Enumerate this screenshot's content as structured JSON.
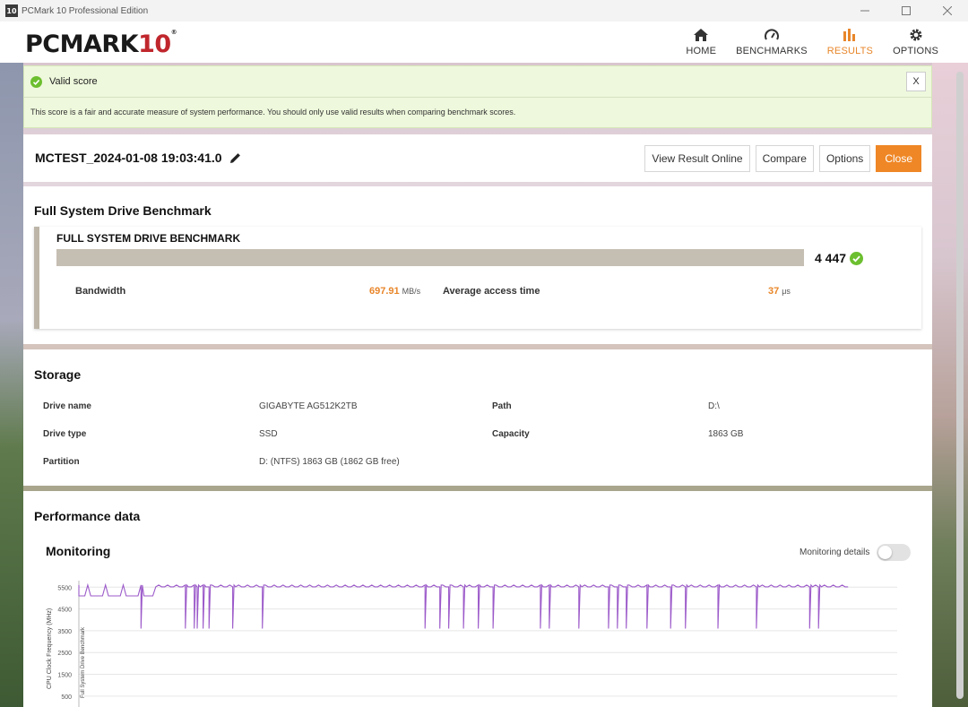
{
  "window": {
    "app_icon": "10",
    "title": "PCMark 10 Professional Edition"
  },
  "brand": {
    "main": "PCMARK",
    "num": "10",
    "reg": "®",
    "accent_color": "#c0272d"
  },
  "nav": [
    {
      "label": "HOME",
      "icon": "home-icon",
      "active": false
    },
    {
      "label": "BENCHMARKS",
      "icon": "speedometer-icon",
      "active": false
    },
    {
      "label": "RESULTS",
      "icon": "bar-chart-icon",
      "active": true
    },
    {
      "label": "OPTIONS",
      "icon": "gear-icon",
      "active": false
    }
  ],
  "valid": {
    "title": "Valid score",
    "close_label": "X",
    "description": "This score is a fair and accurate measure of system performance. You should only use valid results when comparing benchmark scores."
  },
  "result": {
    "name": "MCTEST_2024-01-08 19:03:41.0",
    "buttons": {
      "view_online": "View Result Online",
      "compare": "Compare",
      "options": "Options",
      "close": "Close"
    }
  },
  "benchmark": {
    "section_title": "Full System Drive Benchmark",
    "card_title": "FULL SYSTEM DRIVE BENCHMARK",
    "score": "4 447",
    "bandwidth_label": "Bandwidth",
    "bandwidth_value": "697.91",
    "bandwidth_unit": "MB/s",
    "access_label": "Average access time",
    "access_value": "37",
    "access_unit": "μs"
  },
  "storage": {
    "title": "Storage",
    "drive_name_label": "Drive name",
    "drive_name": "GIGABYTE AG512K2TB",
    "path_label": "Path",
    "path": "D:\\",
    "drive_type_label": "Drive type",
    "drive_type": "SSD",
    "capacity_label": "Capacity",
    "capacity": "1863 GB",
    "partition_label": "Partition",
    "partition": "D: (NTFS) 1863 GB (1862 GB free)"
  },
  "performance": {
    "title": "Performance data",
    "monitoring_title": "Monitoring",
    "monitoring_details_label": "Monitoring details",
    "monitoring_details_on": false
  },
  "chart_data": {
    "type": "line",
    "ylabel": "CPU Clock Frequency (MHz)",
    "band_label": "Full System Drive Benchmark",
    "yticks": [
      5500,
      4500,
      3500,
      2500,
      1500,
      500
    ],
    "ylim": [
      0,
      5800
    ],
    "series": [
      {
        "color": "#9b59c9",
        "baseline": 5100,
        "peak": 5600,
        "dip": 3600
      }
    ],
    "dip_positions": [
      0.08,
      0.14,
      0.15,
      0.155,
      0.16,
      0.17,
      0.2,
      0.24,
      0.45,
      0.47,
      0.48,
      0.5,
      0.52,
      0.54,
      0.6,
      0.61,
      0.65,
      0.69,
      0.7,
      0.71,
      0.74,
      0.77,
      0.79,
      0.83,
      0.88,
      0.95,
      0.96
    ]
  }
}
